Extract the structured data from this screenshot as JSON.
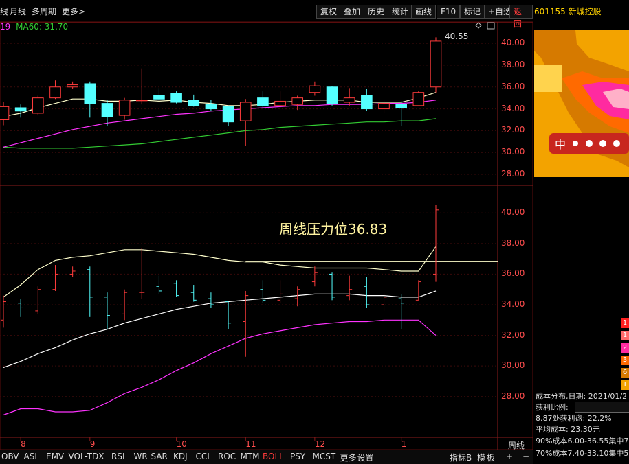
{
  "topbar": {
    "left_items": [
      "线",
      "月线",
      "多周期",
      "更多>"
    ],
    "buttons": [
      "复权",
      "叠加",
      "历史",
      "统计",
      "画线",
      "F10",
      "标记",
      "+自选"
    ],
    "back_button": "返回"
  },
  "ma_legend": {
    "ma30_fragment": "19",
    "ma60_label": "MA60: 31.70"
  },
  "stock": {
    "code": "601155",
    "name": "新城控股"
  },
  "upper_chart": {
    "y_ticks": [
      "40.00",
      "38.00",
      "36.00",
      "34.00",
      "32.00",
      "30.00",
      "28.00"
    ],
    "high_label": "40.55"
  },
  "lower_chart": {
    "y_ticks": [
      "40.00",
      "38.00",
      "36.00",
      "34.00",
      "32.00",
      "30.00",
      "28.00"
    ],
    "annotation": "周线压力位36.83"
  },
  "x_axis": {
    "months": [
      "8",
      "9",
      "10",
      "11",
      "12",
      "1"
    ],
    "period": "周线"
  },
  "bottombar": {
    "indicators": [
      "OBV",
      "ASI",
      "EMV",
      "VOL-TDX",
      "RSI",
      "WR",
      "SAR",
      "KDJ",
      "CCI",
      "ROC",
      "MTM",
      "BOLL",
      "PSY",
      "MCST",
      "更多",
      "设置"
    ],
    "active": "BOLL",
    "right_items": [
      "指标B",
      "模",
      "板",
      "+",
      "−"
    ]
  },
  "cost_panel": {
    "banner": "中",
    "distribution_date": "成本分布,日期: 2021/01/2",
    "profit_ratio_label": "获利比例:",
    "profit_line": "8.87处获利盘: 22.2%",
    "avg_cost": "平均成本: 23.30元",
    "line90": "90%成本6.00-36.55集中7",
    "line70": "70%成本7.40-33.10集中5",
    "swatches": [
      "1",
      "1",
      "2",
      "3",
      "6",
      "1"
    ]
  },
  "colors": {
    "axis_red": "#ff4d4d",
    "up": "#ff3b3b",
    "down": "#54ffff",
    "ma_white": "#ffffcc",
    "ma_magenta": "#ff33ff",
    "ma_green": "#33cc33",
    "stock_title": "#ffd200"
  },
  "chart_data": {
    "type": "candlestick",
    "period": "weekly",
    "candles": [
      {
        "o": 33.0,
        "h": 34.6,
        "l": 32.5,
        "c": 34.2
      },
      {
        "o": 34.1,
        "h": 34.4,
        "l": 33.2,
        "c": 33.8
      },
      {
        "o": 33.6,
        "h": 35.2,
        "l": 33.4,
        "c": 35.0
      },
      {
        "o": 35.0,
        "h": 36.6,
        "l": 34.9,
        "c": 36.0
      },
      {
        "o": 36.0,
        "h": 36.5,
        "l": 35.8,
        "c": 36.2
      },
      {
        "o": 36.3,
        "h": 36.5,
        "l": 33.2,
        "c": 34.5
      },
      {
        "o": 34.5,
        "h": 34.8,
        "l": 32.4,
        "c": 33.3
      },
      {
        "o": 33.4,
        "h": 35.0,
        "l": 33.0,
        "c": 34.8
      },
      {
        "o": 34.8,
        "h": 37.7,
        "l": 34.4,
        "c": 34.8
      },
      {
        "o": 35.2,
        "h": 35.9,
        "l": 34.7,
        "c": 34.9
      },
      {
        "o": 35.4,
        "h": 35.6,
        "l": 34.5,
        "c": 34.6
      },
      {
        "o": 34.8,
        "h": 35.3,
        "l": 34.2,
        "c": 34.3
      },
      {
        "o": 34.4,
        "h": 34.8,
        "l": 33.8,
        "c": 34.0
      },
      {
        "o": 34.2,
        "h": 34.2,
        "l": 32.4,
        "c": 32.8
      },
      {
        "o": 32.9,
        "h": 34.9,
        "l": 30.6,
        "c": 34.6
      },
      {
        "o": 35.0,
        "h": 35.6,
        "l": 34.1,
        "c": 34.3
      },
      {
        "o": 34.3,
        "h": 35.6,
        "l": 34.1,
        "c": 34.7
      },
      {
        "o": 34.4,
        "h": 35.2,
        "l": 33.9,
        "c": 35.0
      },
      {
        "o": 35.5,
        "h": 36.5,
        "l": 35.2,
        "c": 36.1
      },
      {
        "o": 36.0,
        "h": 36.1,
        "l": 34.3,
        "c": 34.5
      },
      {
        "o": 34.6,
        "h": 35.9,
        "l": 34.3,
        "c": 35.0
      },
      {
        "o": 35.2,
        "h": 35.8,
        "l": 33.8,
        "c": 34.0
      },
      {
        "o": 34.0,
        "h": 34.8,
        "l": 33.6,
        "c": 34.5
      },
      {
        "o": 34.4,
        "h": 34.7,
        "l": 32.4,
        "c": 34.1
      },
      {
        "o": 34.3,
        "h": 35.6,
        "l": 34.3,
        "c": 35.5
      },
      {
        "o": 36.0,
        "h": 40.55,
        "l": 35.5,
        "c": 40.2
      }
    ],
    "ma_white": [
      33.3,
      33.6,
      34.1,
      34.5,
      34.9,
      34.9,
      34.7,
      34.7,
      34.8,
      34.7,
      34.8,
      34.6,
      34.5,
      34.3,
      34.3,
      34.4,
      34.6,
      34.7,
      34.8,
      34.8,
      34.8,
      34.6,
      34.6,
      34.6,
      35.0,
      35.5
    ],
    "ma_magenta": [
      30.5,
      30.9,
      31.3,
      31.7,
      32.1,
      32.4,
      32.7,
      32.9,
      33.1,
      33.3,
      33.5,
      33.6,
      33.8,
      33.9,
      34.0,
      34.1,
      34.2,
      34.3,
      34.3,
      34.4,
      34.4,
      34.4,
      34.5,
      34.5,
      34.6,
      34.8
    ],
    "ma_green": [
      30.5,
      30.4,
      30.4,
      30.4,
      30.4,
      30.5,
      30.6,
      30.7,
      30.8,
      31.0,
      31.2,
      31.4,
      31.6,
      31.8,
      32.0,
      32.1,
      32.3,
      32.4,
      32.5,
      32.6,
      32.7,
      32.8,
      32.8,
      32.9,
      32.9,
      33.1
    ],
    "boll_upper": [
      34.5,
      35.3,
      36.3,
      36.9,
      37.1,
      37.2,
      37.4,
      37.6,
      37.6,
      37.5,
      37.4,
      37.3,
      37.1,
      36.9,
      36.8,
      36.8,
      36.6,
      36.5,
      36.4,
      36.4,
      36.4,
      36.4,
      36.3,
      36.2,
      36.2,
      37.8
    ],
    "boll_mid": [
      29.9,
      30.3,
      30.8,
      31.2,
      31.7,
      32.1,
      32.4,
      32.8,
      33.1,
      33.4,
      33.7,
      33.9,
      34.1,
      34.2,
      34.3,
      34.4,
      34.5,
      34.6,
      34.7,
      34.7,
      34.7,
      34.6,
      34.6,
      34.5,
      34.5,
      34.9
    ],
    "boll_lower": [
      26.8,
      27.2,
      27.2,
      27.0,
      27.0,
      27.1,
      27.6,
      28.2,
      28.6,
      29.1,
      29.7,
      30.2,
      30.8,
      31.3,
      31.8,
      32.1,
      32.3,
      32.5,
      32.7,
      32.8,
      32.9,
      32.9,
      33.0,
      33.0,
      33.0,
      32.0
    ],
    "resistance": 36.83,
    "upper_ylim": [
      27.5,
      41.2
    ],
    "lower_ylim": [
      27.0,
      41.0
    ]
  }
}
